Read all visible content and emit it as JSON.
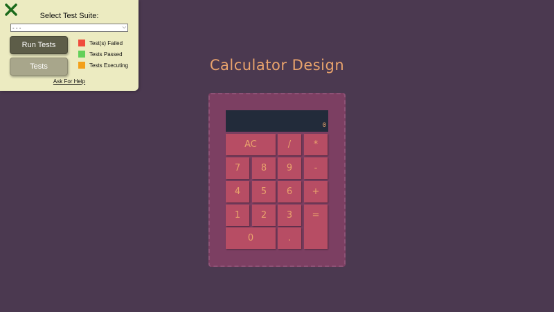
{
  "panel": {
    "title": "Select Test Suite:",
    "select_value": "- - -",
    "run_button": "Run Tests",
    "tests_button": "Tests",
    "help_link": "Ask For Help",
    "legend": [
      {
        "label": "Test(s) Failed",
        "color": "#f04c3c"
      },
      {
        "label": "Tests Passed",
        "color": "#63d05a"
      },
      {
        "label": "Tests Executing",
        "color": "#f3a01a"
      }
    ],
    "close_icon_color": "#1b6a1b"
  },
  "app": {
    "title": "Calculator Design",
    "display": "0"
  },
  "keys": {
    "clear": "AC",
    "divide": "/",
    "multiply": "*",
    "seven": "7",
    "eight": "8",
    "nine": "9",
    "subtract": "-",
    "four": "4",
    "five": "5",
    "six": "6",
    "add": "+",
    "one": "1",
    "two": "2",
    "three": "3",
    "equals": "=",
    "zero": "0",
    "decimal": "."
  },
  "colors": {
    "background": "#4b3950",
    "panel": "#ecebc1",
    "calculator_frame": "#7c3f62",
    "display": "#222b3a",
    "key": "#b74d64",
    "accent": "#e9a36c"
  }
}
